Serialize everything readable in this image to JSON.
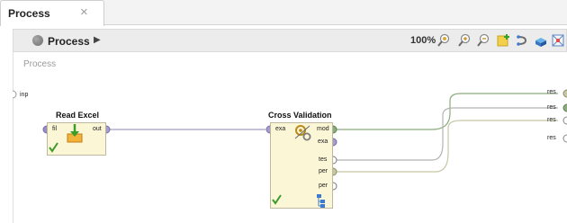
{
  "tab": {
    "label": "Process",
    "close_glyph": "×"
  },
  "toolbar": {
    "process_label": "Process",
    "process_arrow": "▶",
    "zoom": "100%",
    "icons": [
      "zoom-fit-icon",
      "zoom-in-icon",
      "zoom-out-icon",
      "add-note-icon",
      "auto-wire-icon",
      "arrange-operators-icon",
      "grid-icon"
    ]
  },
  "canvas": {
    "title": "Process",
    "input_port": "inp",
    "result_ports": [
      "res",
      "res",
      "res",
      "res"
    ]
  },
  "operators": {
    "read_excel": {
      "title": "Read Excel",
      "in_port": "fil",
      "out_port": "out"
    },
    "cross_validation": {
      "title": "Cross Validation",
      "in_port": "exa",
      "out_ports": [
        "mod",
        "exa",
        "tes",
        "per",
        "per"
      ]
    }
  },
  "colors": {
    "model_wire": "#8aac7e",
    "example_wire": "#a89cc8",
    "test_wire": "#b4b4b4",
    "perf_wire": "#c6c7a4",
    "status_ok": "#3c9b2c"
  }
}
